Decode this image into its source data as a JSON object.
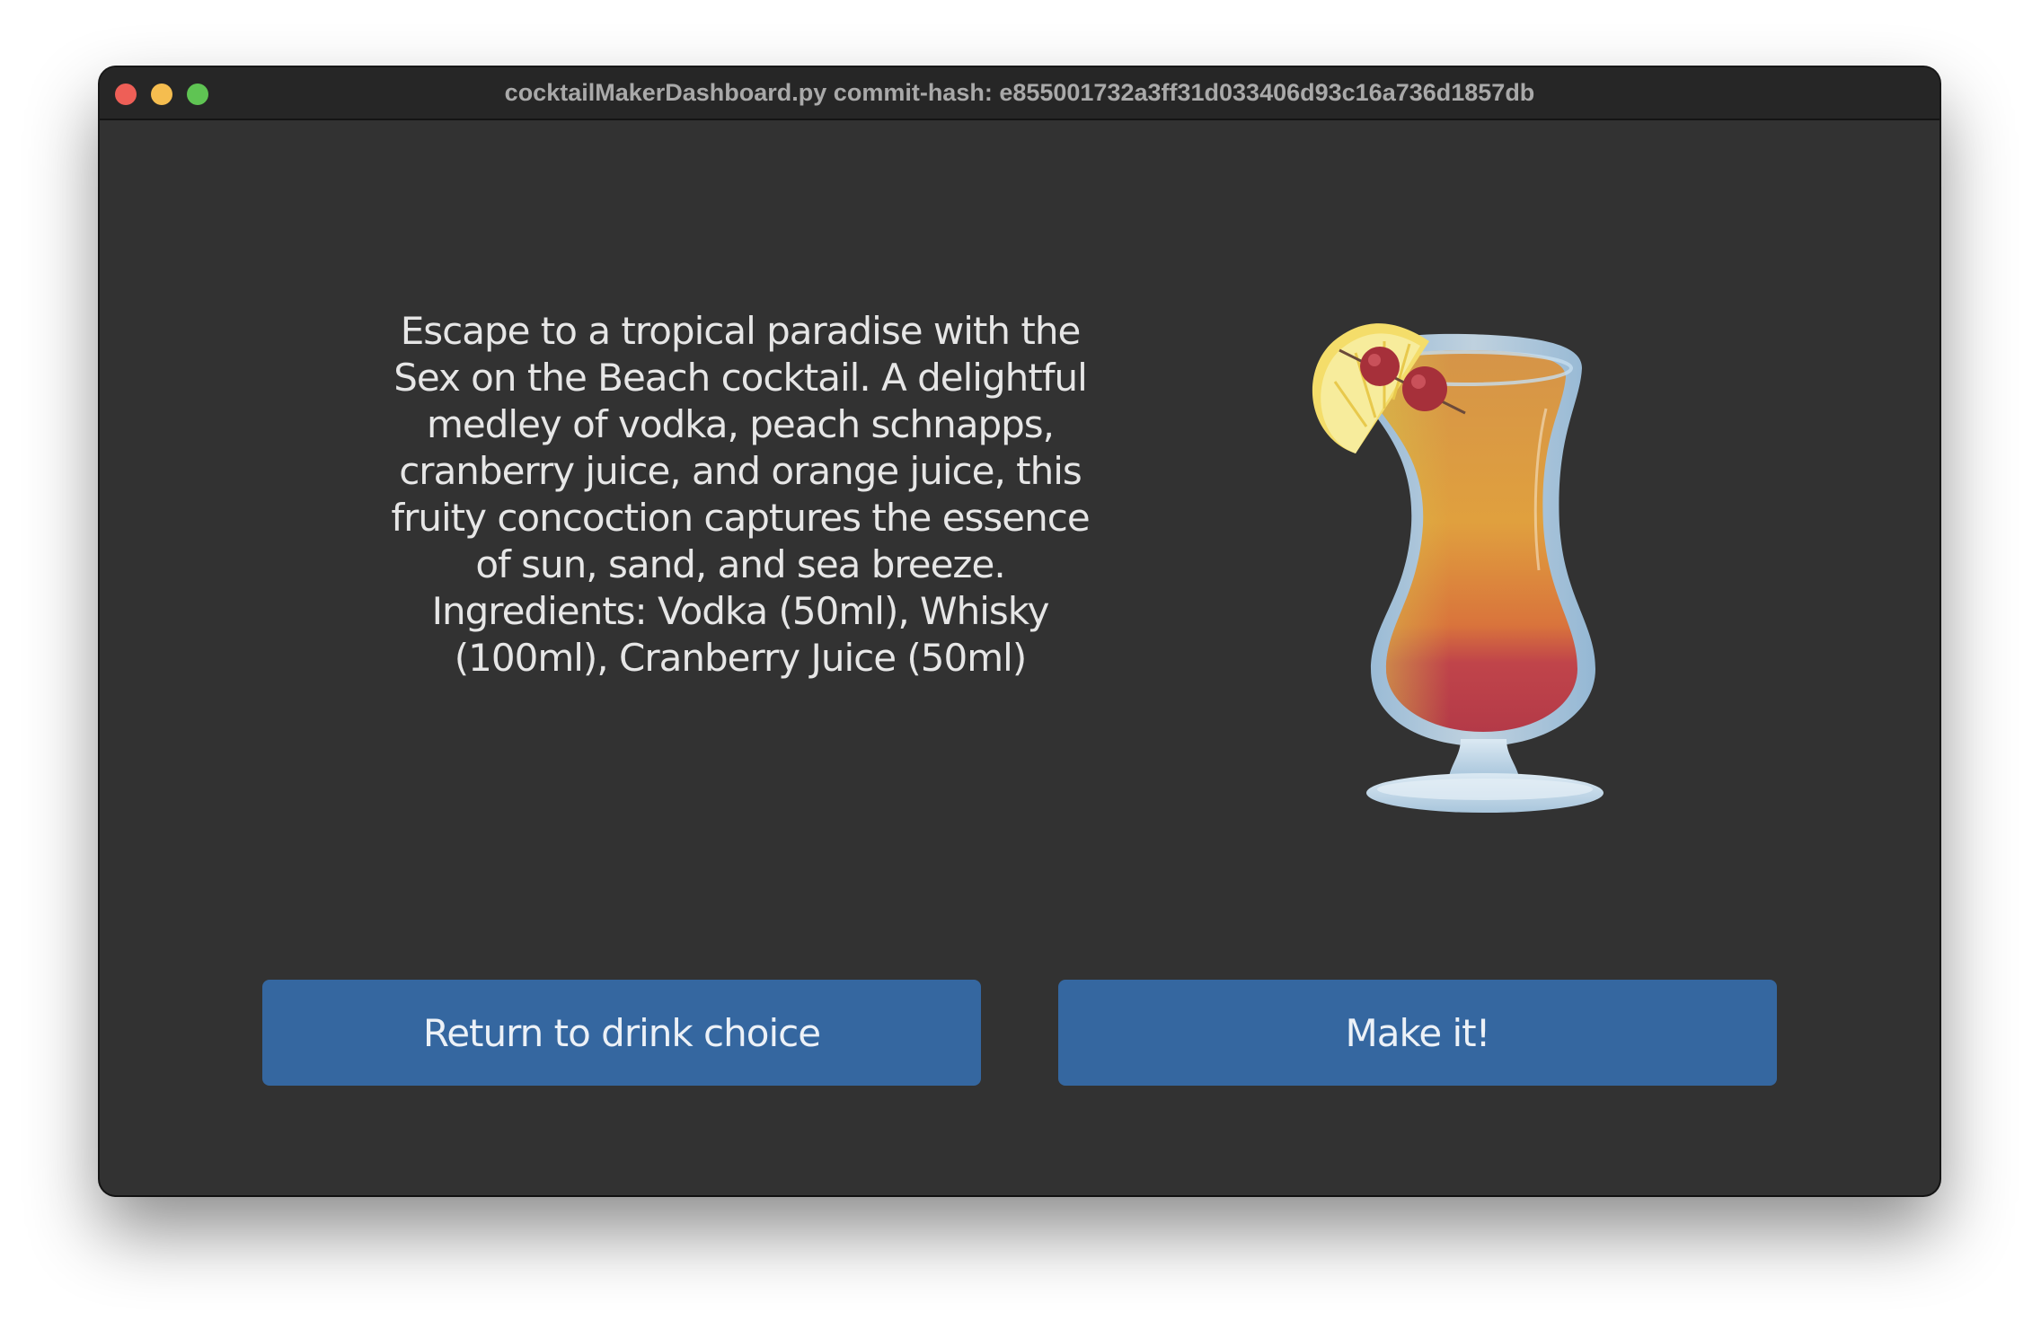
{
  "window": {
    "title": "cocktailMakerDashboard.py commit-hash: e855001732a3ff31d033406d93c16a736d1857db"
  },
  "drink": {
    "description": "Escape to a tropical paradise with the Sex on the Beach cocktail. A delightful medley of vodka, peach schnapps, cranberry juice, and orange juice, this fruity concoction captures the essence of sun, sand, and sea breeze. Ingredients: Vodka (50ml), Whisky (100ml), Cranberry Juice (50ml)"
  },
  "buttons": {
    "return_label": "Return to drink choice",
    "make_label": "Make it!"
  },
  "colors": {
    "background": "#323232",
    "titlebar": "#262626",
    "button": "#3567a0"
  }
}
